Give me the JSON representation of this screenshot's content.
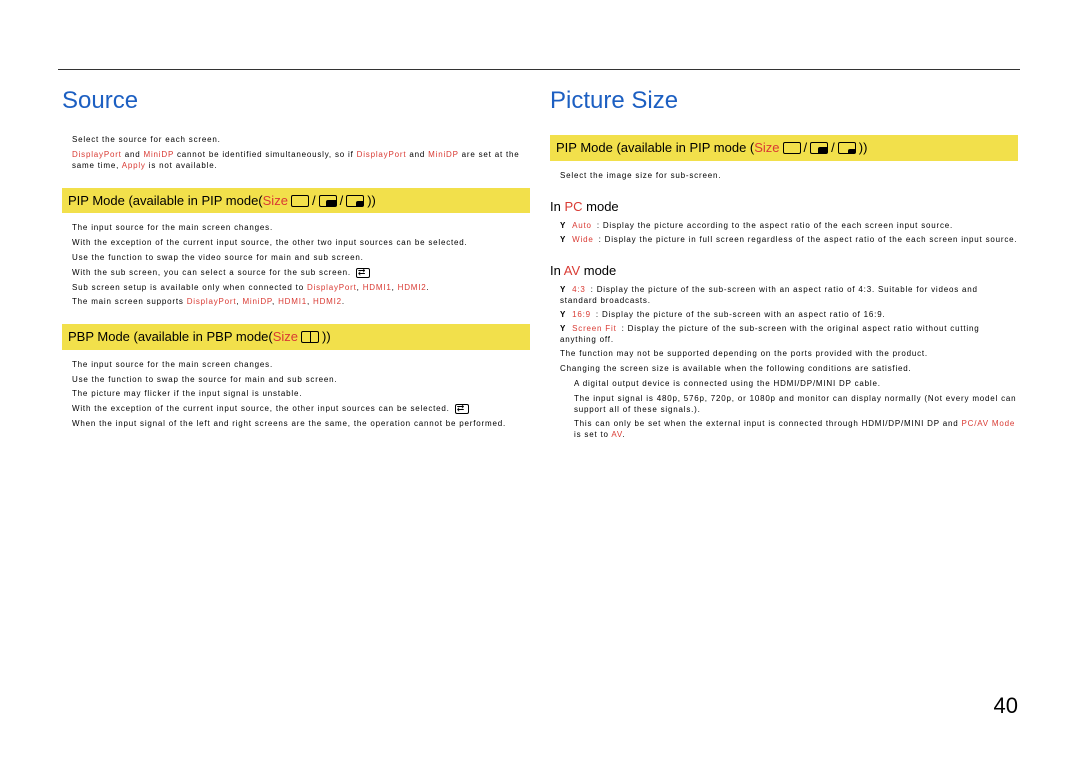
{
  "page_number": "40",
  "left": {
    "title": "Source",
    "intro_line1": "Select the source for each screen.",
    "intro_dp": "DisplayPort",
    "intro_and": " and ",
    "intro_minidp": "MiniDP",
    "intro_tail1": " cannot be identified simultaneously, so if ",
    "intro_dp2": "DisplayPort",
    "intro_and2": " and ",
    "intro_minidp2": "MiniDP",
    "intro_tail2": " are set at the same time, ",
    "intro_apply": "Apply",
    "intro_tail3": " is not available.",
    "pip_bar_pre": "PIP Mode (available in PIP mode(",
    "pip_bar_size": "Size ",
    "pip_bar_sep": " / ",
    "pip_bar_close": "))",
    "pip_items": [
      "The input source for the main screen changes.",
      "With the exception of the current input source, the other two input sources can be selected.",
      "Use the function to swap the video source for main and sub screen.",
      "With the sub screen, you can select a source for the sub screen.",
      "Sub screen setup is available only when connected to ",
      "The main screen supports "
    ],
    "pip_item5_tail": ", HDMI1, HDMI2.",
    "pip_item6_tail": ", MiniDP, HDMI1, HDMI2.",
    "hl_dp": "DisplayPort",
    "hl_minidp": "MiniDP",
    "hl_h1": "HDMI1",
    "hl_h2": "HDMI2",
    "pbp_bar_pre": "PBP Mode (available in PBP mode(",
    "pbp_bar_size": "Size ",
    "pbp_bar_close": "))",
    "pbp_items": [
      "The input source for the main screen changes.",
      "Use the function to swap the source for main and sub screen.",
      "The picture may flicker if the input signal is unstable.",
      "With the exception of the current input source, the other input sources can be selected.",
      "When the input signal of the left and right screens are the same, the operation cannot be performed."
    ]
  },
  "right": {
    "title": "Picture Size",
    "bar_pre": "PIP Mode  (available in PIP mode (",
    "bar_size": "Size ",
    "bar_sep": " / ",
    "bar_close": "))",
    "lead": "Select the image size for sub-screen.",
    "pc_heading_pre": "In ",
    "pc_heading_hl": "PC",
    "pc_heading_post": " mode",
    "pc_items": [
      {
        "hl": "Auto",
        "desc": ": Display the picture according to the aspect ratio of the each screen input source."
      },
      {
        "hl": "Wide",
        "desc": ": Display the picture in full screen regardless of the aspect ratio of the each screen input source."
      }
    ],
    "av_heading_pre": "In ",
    "av_heading_hl": "AV",
    "av_heading_post": " mode",
    "av_items": [
      {
        "hl": "4:3",
        "desc": ": Display the picture of the sub-screen with an aspect ratio of 4:3. Suitable for videos and standard broadcasts."
      },
      {
        "hl": "16:9",
        "desc": ": Display the picture of the sub-screen with an aspect ratio of 16:9."
      },
      {
        "hl": "Screen Fit",
        "desc": ": Display the picture of the sub-screen with the original aspect ratio without cutting anything off."
      }
    ],
    "notes": [
      "The function may not be supported depending on the ports provided with the product.",
      "Changing the screen size is available when the following conditions are satisfied.",
      "A digital output device is connected using the HDMI/DP/MINI DP cable.",
      "The input signal is 480p, 576p, 720p, or 1080p and monitor can display normally (Not every model can support all of these signals.).",
      "This can only be set when the external input is connected through HDMI/DP/MINI DP and "
    ],
    "note5_hl1": "PC/AV Mode",
    "note5_mid": " is set to ",
    "note5_hl2": "AV",
    "note5_tail": "."
  }
}
